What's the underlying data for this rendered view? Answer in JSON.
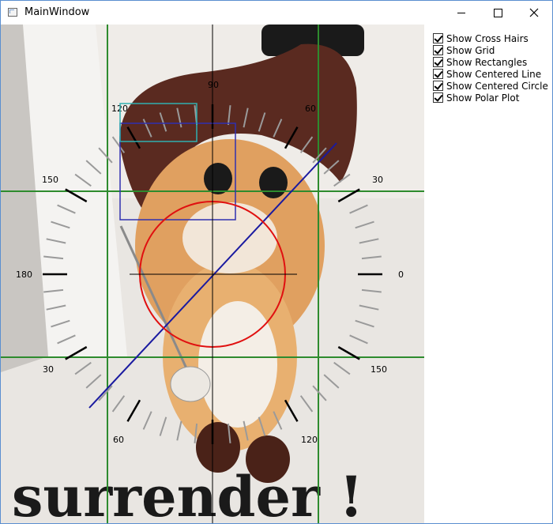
{
  "window": {
    "title": "MainWindow"
  },
  "image": {
    "caption": "surrender !"
  },
  "options": [
    {
      "label": "Show Cross Hairs",
      "checked": true
    },
    {
      "label": "Show Grid",
      "checked": true
    },
    {
      "label": "Show Rectangles",
      "checked": true
    },
    {
      "label": "Show Centered Line",
      "checked": true
    },
    {
      "label": "Show Centered Circle",
      "checked": true
    },
    {
      "label": "Show Polar Plot",
      "checked": true
    }
  ],
  "polar_labels": [
    "0",
    "30",
    "60",
    "90",
    "120",
    "150",
    "180",
    "150",
    "120",
    "60",
    "30"
  ],
  "colors": {
    "grid": "#2e8b2e",
    "circle": "#e01010",
    "centered_line": "#1a1aa0",
    "rect_1": "#3030b0",
    "rect_2": "#30b0b0",
    "crosshair": "#000000"
  }
}
